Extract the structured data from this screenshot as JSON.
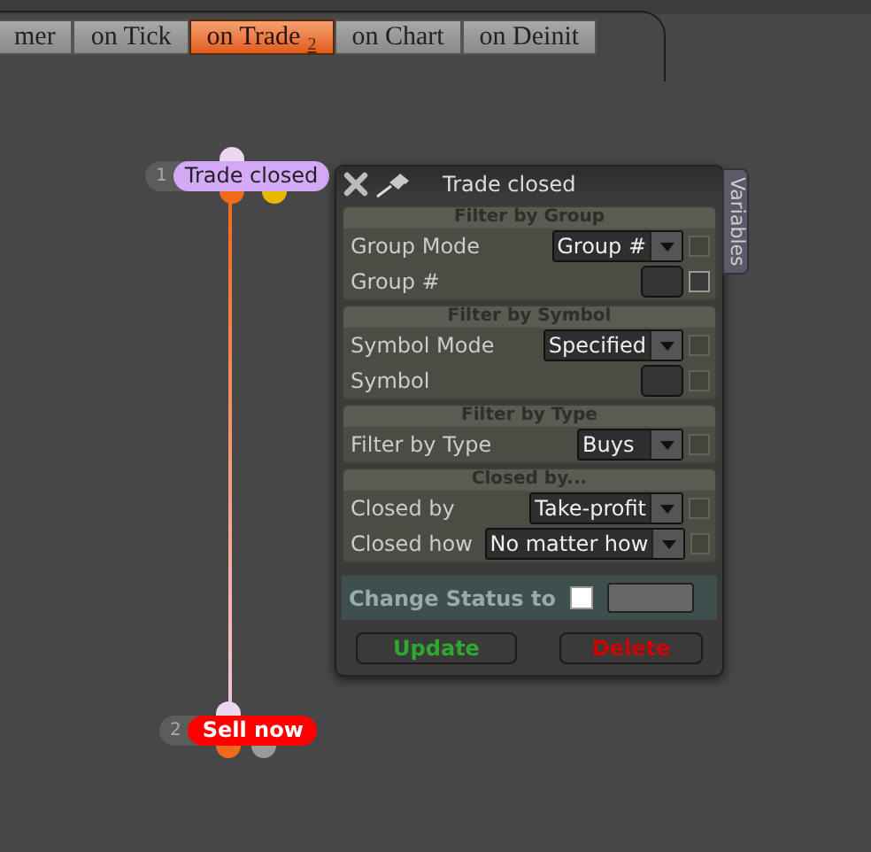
{
  "tabs": [
    {
      "label": "mer",
      "selected": false
    },
    {
      "label": "on Tick",
      "selected": false
    },
    {
      "label": "on Trade",
      "badge": "2",
      "selected": true
    },
    {
      "label": "on Chart",
      "selected": false
    },
    {
      "label": "on Deinit",
      "selected": false
    }
  ],
  "nodes": [
    {
      "kind": "event",
      "number": "1",
      "label": "Trade closed",
      "color": "#d4aaf7"
    },
    {
      "kind": "action",
      "number": "2",
      "label": "Sell now",
      "color": "#ff0000"
    }
  ],
  "panel": {
    "title": "Trade closed",
    "side_tab": "Variables",
    "sections": [
      {
        "title": "Filter by Group",
        "rows": [
          {
            "kind": "dropdown",
            "label": "Group Mode",
            "value": "Group #",
            "checkbox_enabled": false
          },
          {
            "kind": "field",
            "label": "Group #",
            "checkbox_enabled": true
          }
        ]
      },
      {
        "title": "Filter by Symbol",
        "rows": [
          {
            "kind": "dropdown",
            "label": "Symbol Mode",
            "value": "Specified",
            "checkbox_enabled": false
          },
          {
            "kind": "field",
            "label": "Symbol",
            "checkbox_enabled": false
          }
        ]
      },
      {
        "title": "Filter by Type",
        "rows": [
          {
            "kind": "dropdown",
            "label": "Filter by Type",
            "value": "Buys",
            "checkbox_enabled": false
          }
        ]
      },
      {
        "title": "Closed by...",
        "rows": [
          {
            "kind": "dropdown",
            "label": "Closed by",
            "value": "Take-profit",
            "checkbox_enabled": false
          },
          {
            "kind": "dropdown",
            "label": "Closed how",
            "value": "No matter how",
            "checkbox_enabled": false
          }
        ]
      }
    ],
    "status": {
      "label": "Change Status to",
      "checked": false
    },
    "buttons": [
      {
        "kind": "update",
        "label": "Update"
      },
      {
        "kind": "delete",
        "label": "Delete"
      }
    ]
  }
}
